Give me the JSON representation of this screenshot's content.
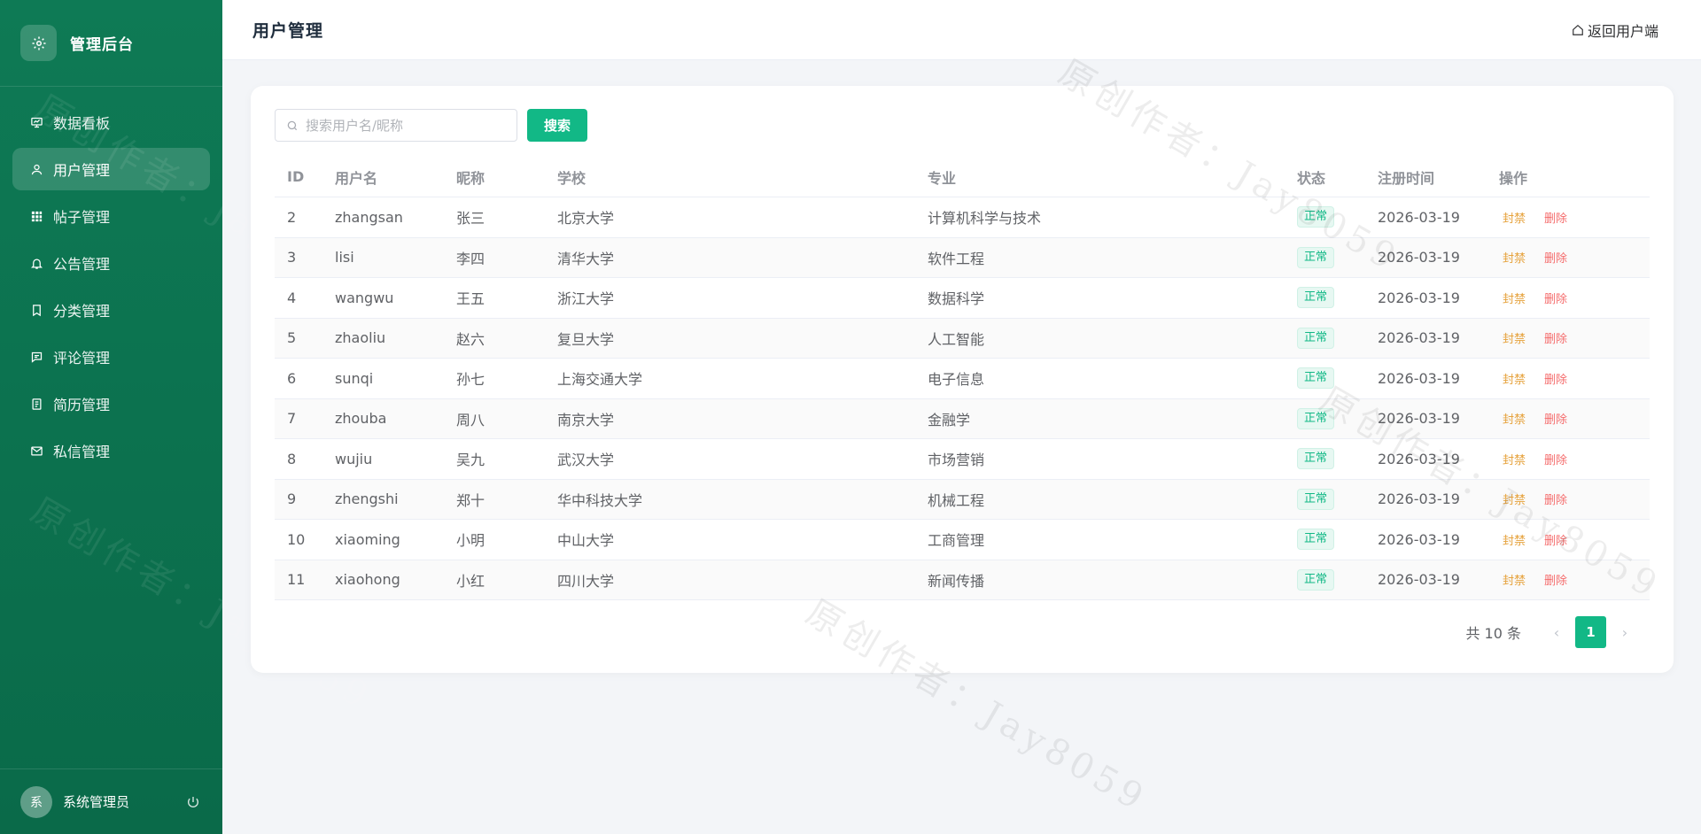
{
  "sidebar": {
    "brand": "管理后台",
    "brand_icon": "gear-icon",
    "items": [
      {
        "label": "数据看板",
        "icon": "dashboard-icon"
      },
      {
        "label": "用户管理",
        "icon": "user-icon",
        "active": true
      },
      {
        "label": "帖子管理",
        "icon": "grid-icon"
      },
      {
        "label": "公告管理",
        "icon": "bell-icon"
      },
      {
        "label": "分类管理",
        "icon": "bookmark-icon"
      },
      {
        "label": "评论管理",
        "icon": "comment-icon"
      },
      {
        "label": "简历管理",
        "icon": "document-icon"
      },
      {
        "label": "私信管理",
        "icon": "mail-icon"
      }
    ],
    "user": {
      "avatar_text": "系",
      "name": "系统管理员"
    }
  },
  "header": {
    "title": "用户管理",
    "back_label": "返回用户端"
  },
  "search": {
    "placeholder": "搜索用户名/昵称",
    "value": "",
    "button": "搜索"
  },
  "table": {
    "columns": [
      "ID",
      "用户名",
      "昵称",
      "学校",
      "专业",
      "状态",
      "注册时间",
      "操作"
    ],
    "rows": [
      {
        "id": "2",
        "username": "zhangsan",
        "nickname": "张三",
        "school": "北京大学",
        "major": "计算机科学与技术",
        "status": "正常",
        "date": "2026-03-19"
      },
      {
        "id": "3",
        "username": "lisi",
        "nickname": "李四",
        "school": "清华大学",
        "major": "软件工程",
        "status": "正常",
        "date": "2026-03-19"
      },
      {
        "id": "4",
        "username": "wangwu",
        "nickname": "王五",
        "school": "浙江大学",
        "major": "数据科学",
        "status": "正常",
        "date": "2026-03-19"
      },
      {
        "id": "5",
        "username": "zhaoliu",
        "nickname": "赵六",
        "school": "复旦大学",
        "major": "人工智能",
        "status": "正常",
        "date": "2026-03-19"
      },
      {
        "id": "6",
        "username": "sunqi",
        "nickname": "孙七",
        "school": "上海交通大学",
        "major": "电子信息",
        "status": "正常",
        "date": "2026-03-19"
      },
      {
        "id": "7",
        "username": "zhouba",
        "nickname": "周八",
        "school": "南京大学",
        "major": "金融学",
        "status": "正常",
        "date": "2026-03-19"
      },
      {
        "id": "8",
        "username": "wujiu",
        "nickname": "吴九",
        "school": "武汉大学",
        "major": "市场营销",
        "status": "正常",
        "date": "2026-03-19"
      },
      {
        "id": "9",
        "username": "zhengshi",
        "nickname": "郑十",
        "school": "华中科技大学",
        "major": "机械工程",
        "status": "正常",
        "date": "2026-03-19"
      },
      {
        "id": "10",
        "username": "xiaoming",
        "nickname": "小明",
        "school": "中山大学",
        "major": "工商管理",
        "status": "正常",
        "date": "2026-03-19"
      },
      {
        "id": "11",
        "username": "xiaohong",
        "nickname": "小红",
        "school": "四川大学",
        "major": "新闻传播",
        "status": "正常",
        "date": "2026-03-19"
      }
    ],
    "op_ban": "封禁",
    "op_delete": "删除"
  },
  "pagination": {
    "total": "共 10 条",
    "current_page": "1"
  },
  "watermark": "原创作者：Jay8059",
  "colors": {
    "sidebar": "#0e7a55",
    "accent": "#12b886",
    "warning": "#e6a23c",
    "danger": "#f56c6c"
  }
}
